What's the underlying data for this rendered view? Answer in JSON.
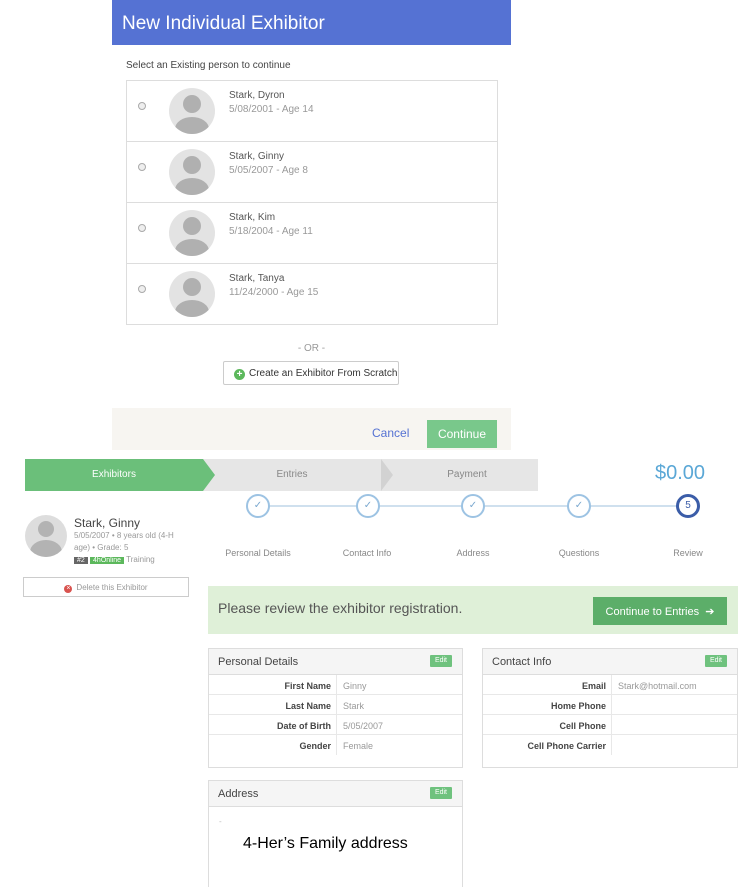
{
  "modal": {
    "title": "New Individual Exhibitor",
    "select_label": "Select an Existing person to continue",
    "people": [
      {
        "name": "Stark, Dyron",
        "sub": "5/08/2001 - Age 14"
      },
      {
        "name": "Stark, Ginny",
        "sub": "5/05/2007 - Age 8"
      },
      {
        "name": "Stark, Kim",
        "sub": "5/18/2004 - Age 11"
      },
      {
        "name": "Stark, Tanya",
        "sub": "11/24/2000 - Age 15"
      }
    ],
    "or_text": "- OR -",
    "scratch_label": "Create an Exhibitor From Scratch",
    "cancel_label": "Cancel",
    "continue_label": "Continue"
  },
  "progress": {
    "steps": [
      "Exhibitors",
      "Entries",
      "Payment"
    ],
    "total": "$0.00"
  },
  "exhibitor": {
    "name": "Stark, Ginny",
    "line1": "5/05/2007 • 8 years old (4-H",
    "line2": "age) • Grade: 5",
    "tag_num": "#2",
    "tag_status": "4hOnline",
    "tag_text": "Training",
    "delete_label": "Delete this Exhibitor"
  },
  "wizard": {
    "steps": [
      {
        "label": "Personal Details",
        "icon": "✓"
      },
      {
        "label": "Contact Info",
        "icon": "✓"
      },
      {
        "label": "Address",
        "icon": "✓"
      },
      {
        "label": "Questions",
        "icon": "✓"
      },
      {
        "label": "Review",
        "icon": "5"
      }
    ]
  },
  "review": {
    "message": "Please review the exhibitor registration.",
    "button_label": "Continue to Entries"
  },
  "personal": {
    "title": "Personal Details",
    "edit": "Edit",
    "rows": [
      {
        "label": "First Name",
        "value": "Ginny"
      },
      {
        "label": "Last Name",
        "value": "Stark"
      },
      {
        "label": "Date of Birth",
        "value": "5/05/2007"
      },
      {
        "label": "Gender",
        "value": "Female"
      }
    ]
  },
  "contact": {
    "title": "Contact Info",
    "edit": "Edit",
    "rows": [
      {
        "label": "Email",
        "value": "Stark@hotmail.com"
      },
      {
        "label": "Home Phone",
        "value": ""
      },
      {
        "label": "Cell Phone",
        "value": ""
      },
      {
        "label": "Cell Phone Carrier",
        "value": ""
      }
    ]
  },
  "address": {
    "title": "Address",
    "edit": "Edit",
    "dot": "-",
    "note": "4-Her’s Family address"
  },
  "colors": {
    "header_blue": "#5572d3",
    "green": "#5cae69",
    "banner_green": "#dff0d8",
    "total_blue": "#5aa7d6"
  }
}
